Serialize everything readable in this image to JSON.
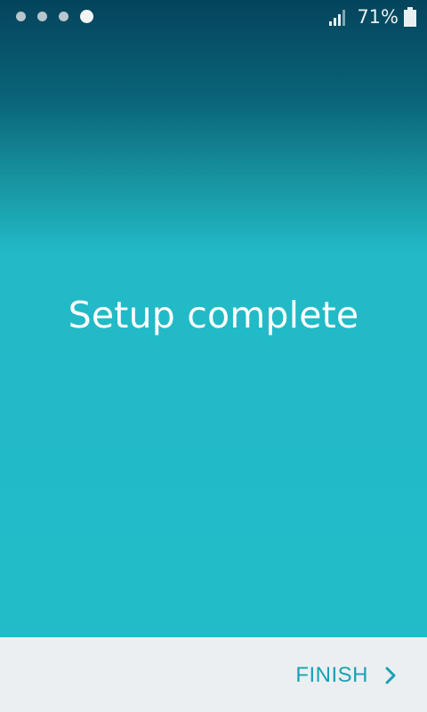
{
  "status_bar": {
    "page_dots": {
      "count": 4,
      "active_index": 3
    },
    "signal_icon": "cell-signal-icon",
    "battery_percent_label": "71%",
    "battery_icon": "battery-icon"
  },
  "main": {
    "title": "Setup complete"
  },
  "footer": {
    "finish_label": "FINISH",
    "finish_icon": "chevron-right-icon"
  },
  "colors": {
    "accent": "#1aa1b3",
    "background_top": "#04445c",
    "background_main": "#22bbc8",
    "footer_bg": "#eceff1"
  }
}
